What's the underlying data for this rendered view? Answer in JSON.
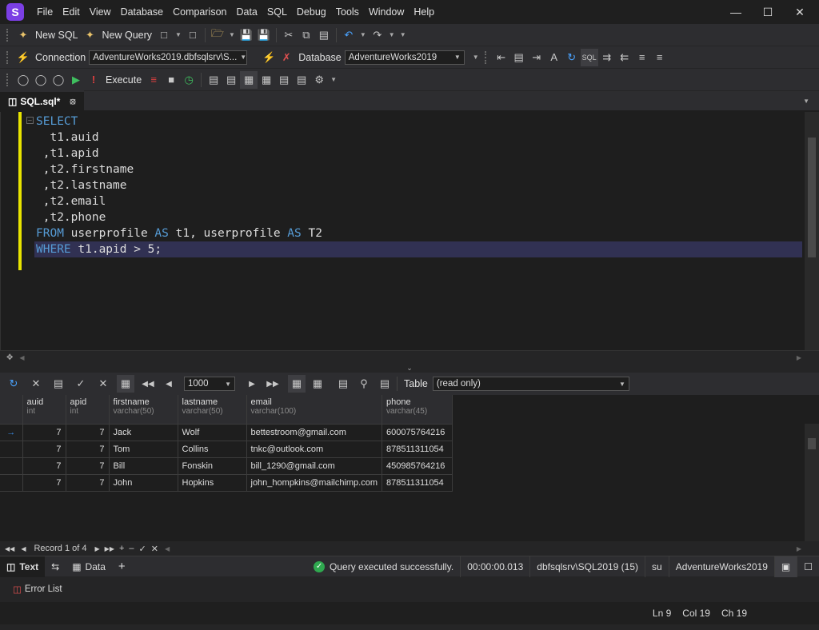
{
  "app": {
    "logo_letter": "S",
    "accent": "#7b3fe4"
  },
  "menu": [
    "File",
    "Edit",
    "View",
    "Database",
    "Comparison",
    "Data",
    "SQL",
    "Debug",
    "Tools",
    "Window",
    "Help"
  ],
  "toolbar1": {
    "new_sql": "New SQL",
    "new_query": "New Query"
  },
  "toolbar2": {
    "connection_label": "Connection",
    "connection_value": "AdventureWorks2019.dbfsqlsrv\\S...",
    "database_label": "Database",
    "database_value": "AdventureWorks2019"
  },
  "toolbar3": {
    "execute": "Execute"
  },
  "doc_tab": {
    "label": "SQL.sql*"
  },
  "editor": {
    "lines": [
      {
        "kw": "SELECT",
        "rest": ""
      },
      {
        "kw": "",
        "rest": "  t1.auid"
      },
      {
        "kw": "",
        "rest": " ,t1.apid"
      },
      {
        "kw": "",
        "rest": " ,t2.firstname"
      },
      {
        "kw": "",
        "rest": " ,t2.lastname"
      },
      {
        "kw": "",
        "rest": " ,t2.email"
      },
      {
        "kw": "",
        "rest": " ,t2.phone"
      }
    ],
    "from_kw": "FROM",
    "from_t1": " userprofile ",
    "as1": "AS",
    "t1": " t1, userprofile ",
    "as2": "AS",
    "t2": " T2",
    "where_kw": "WHERE",
    "where_rest": " t1.apid > 5;"
  },
  "grid_toolbar": {
    "page_size": "1000",
    "view_label": "Table",
    "view_value": "(read only)"
  },
  "grid": {
    "columns": [
      {
        "name": "auid",
        "type": "int"
      },
      {
        "name": "apid",
        "type": "int"
      },
      {
        "name": "firstname",
        "type": "varchar(50)"
      },
      {
        "name": "lastname",
        "type": "varchar(50)"
      },
      {
        "name": "email",
        "type": "varchar(100)"
      },
      {
        "name": "phone",
        "type": "varchar(45)"
      }
    ],
    "rows": [
      [
        "7",
        "7",
        "Jack",
        "Wolf",
        "bettestroom@gmail.com",
        "600075764216"
      ],
      [
        "7",
        "7",
        "Tom",
        "Collins",
        "tnkc@outlook.com",
        "878511311054"
      ],
      [
        "7",
        "7",
        "Bill",
        "Fonskin",
        "bill_1290@gmail.com",
        "450985764216"
      ],
      [
        "7",
        "7",
        "John",
        "Hopkins",
        "john_hompkins@mailchimp.com",
        "878511311054"
      ]
    ],
    "record_text": "Record 1 of 4"
  },
  "result_tabs": {
    "text": "Text",
    "data": "Data"
  },
  "status": {
    "message": "Query executed successfully.",
    "elapsed": "00:00:00.013",
    "server": "dbfsqlsrv\\SQL2019 (15)",
    "user": "su",
    "database": "AdventureWorks2019"
  },
  "error_list": "Error List",
  "statusbar": {
    "ln": "Ln 9",
    "col": "Col 19",
    "ch": "Ch 19"
  }
}
